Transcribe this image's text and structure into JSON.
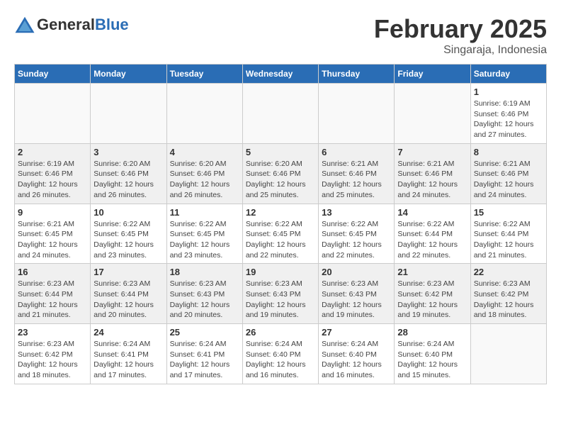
{
  "header": {
    "logo_general": "General",
    "logo_blue": "Blue",
    "month": "February 2025",
    "location": "Singaraja, Indonesia"
  },
  "weekdays": [
    "Sunday",
    "Monday",
    "Tuesday",
    "Wednesday",
    "Thursday",
    "Friday",
    "Saturday"
  ],
  "weeks": [
    [
      {
        "day": "",
        "detail": ""
      },
      {
        "day": "",
        "detail": ""
      },
      {
        "day": "",
        "detail": ""
      },
      {
        "day": "",
        "detail": ""
      },
      {
        "day": "",
        "detail": ""
      },
      {
        "day": "",
        "detail": ""
      },
      {
        "day": "1",
        "detail": "Sunrise: 6:19 AM\nSunset: 6:46 PM\nDaylight: 12 hours and 27 minutes."
      }
    ],
    [
      {
        "day": "2",
        "detail": "Sunrise: 6:19 AM\nSunset: 6:46 PM\nDaylight: 12 hours and 26 minutes."
      },
      {
        "day": "3",
        "detail": "Sunrise: 6:20 AM\nSunset: 6:46 PM\nDaylight: 12 hours and 26 minutes."
      },
      {
        "day": "4",
        "detail": "Sunrise: 6:20 AM\nSunset: 6:46 PM\nDaylight: 12 hours and 26 minutes."
      },
      {
        "day": "5",
        "detail": "Sunrise: 6:20 AM\nSunset: 6:46 PM\nDaylight: 12 hours and 25 minutes."
      },
      {
        "day": "6",
        "detail": "Sunrise: 6:21 AM\nSunset: 6:46 PM\nDaylight: 12 hours and 25 minutes."
      },
      {
        "day": "7",
        "detail": "Sunrise: 6:21 AM\nSunset: 6:46 PM\nDaylight: 12 hours and 24 minutes."
      },
      {
        "day": "8",
        "detail": "Sunrise: 6:21 AM\nSunset: 6:46 PM\nDaylight: 12 hours and 24 minutes."
      }
    ],
    [
      {
        "day": "9",
        "detail": "Sunrise: 6:21 AM\nSunset: 6:45 PM\nDaylight: 12 hours and 24 minutes."
      },
      {
        "day": "10",
        "detail": "Sunrise: 6:22 AM\nSunset: 6:45 PM\nDaylight: 12 hours and 23 minutes."
      },
      {
        "day": "11",
        "detail": "Sunrise: 6:22 AM\nSunset: 6:45 PM\nDaylight: 12 hours and 23 minutes."
      },
      {
        "day": "12",
        "detail": "Sunrise: 6:22 AM\nSunset: 6:45 PM\nDaylight: 12 hours and 22 minutes."
      },
      {
        "day": "13",
        "detail": "Sunrise: 6:22 AM\nSunset: 6:45 PM\nDaylight: 12 hours and 22 minutes."
      },
      {
        "day": "14",
        "detail": "Sunrise: 6:22 AM\nSunset: 6:44 PM\nDaylight: 12 hours and 22 minutes."
      },
      {
        "day": "15",
        "detail": "Sunrise: 6:22 AM\nSunset: 6:44 PM\nDaylight: 12 hours and 21 minutes."
      }
    ],
    [
      {
        "day": "16",
        "detail": "Sunrise: 6:23 AM\nSunset: 6:44 PM\nDaylight: 12 hours and 21 minutes."
      },
      {
        "day": "17",
        "detail": "Sunrise: 6:23 AM\nSunset: 6:44 PM\nDaylight: 12 hours and 20 minutes."
      },
      {
        "day": "18",
        "detail": "Sunrise: 6:23 AM\nSunset: 6:43 PM\nDaylight: 12 hours and 20 minutes."
      },
      {
        "day": "19",
        "detail": "Sunrise: 6:23 AM\nSunset: 6:43 PM\nDaylight: 12 hours and 19 minutes."
      },
      {
        "day": "20",
        "detail": "Sunrise: 6:23 AM\nSunset: 6:43 PM\nDaylight: 12 hours and 19 minutes."
      },
      {
        "day": "21",
        "detail": "Sunrise: 6:23 AM\nSunset: 6:42 PM\nDaylight: 12 hours and 19 minutes."
      },
      {
        "day": "22",
        "detail": "Sunrise: 6:23 AM\nSunset: 6:42 PM\nDaylight: 12 hours and 18 minutes."
      }
    ],
    [
      {
        "day": "23",
        "detail": "Sunrise: 6:23 AM\nSunset: 6:42 PM\nDaylight: 12 hours and 18 minutes."
      },
      {
        "day": "24",
        "detail": "Sunrise: 6:24 AM\nSunset: 6:41 PM\nDaylight: 12 hours and 17 minutes."
      },
      {
        "day": "25",
        "detail": "Sunrise: 6:24 AM\nSunset: 6:41 PM\nDaylight: 12 hours and 17 minutes."
      },
      {
        "day": "26",
        "detail": "Sunrise: 6:24 AM\nSunset: 6:40 PM\nDaylight: 12 hours and 16 minutes."
      },
      {
        "day": "27",
        "detail": "Sunrise: 6:24 AM\nSunset: 6:40 PM\nDaylight: 12 hours and 16 minutes."
      },
      {
        "day": "28",
        "detail": "Sunrise: 6:24 AM\nSunset: 6:40 PM\nDaylight: 12 hours and 15 minutes."
      },
      {
        "day": "",
        "detail": ""
      }
    ]
  ]
}
